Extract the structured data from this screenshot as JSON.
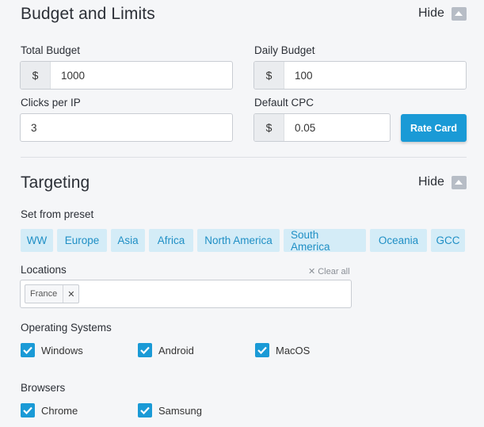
{
  "budget": {
    "title": "Budget and Limits",
    "hide_label": "Hide",
    "total_budget": {
      "label": "Total Budget",
      "prefix": "$",
      "value": "1000"
    },
    "daily_budget": {
      "label": "Daily Budget",
      "prefix": "$",
      "value": "100"
    },
    "clicks_per_ip": {
      "label": "Clicks per IP",
      "value": "3"
    },
    "default_cpc": {
      "label": "Default CPC",
      "prefix": "$",
      "value": "0.05"
    },
    "rate_card_label": "Rate Card"
  },
  "targeting": {
    "title": "Targeting",
    "hide_label": "Hide",
    "preset_label": "Set from preset",
    "presets": [
      "WW",
      "Europe",
      "Asia",
      "Africa",
      "North America",
      "South America",
      "Oceania",
      "GCC"
    ],
    "locations": {
      "label": "Locations",
      "clear_all": "Clear all",
      "tags": [
        "France"
      ]
    },
    "os": {
      "label": "Operating Systems",
      "options": [
        {
          "label": "Windows",
          "checked": true
        },
        {
          "label": "Android",
          "checked": true
        },
        {
          "label": "MacOS",
          "checked": true
        }
      ]
    },
    "browsers": {
      "label": "Browsers",
      "options": [
        {
          "label": "Chrome",
          "checked": true
        },
        {
          "label": "Samsung",
          "checked": true
        }
      ]
    }
  },
  "colors": {
    "accent": "#1a9ad6",
    "preset_bg": "#d4ecf7",
    "preset_text": "#1f8fc5"
  }
}
